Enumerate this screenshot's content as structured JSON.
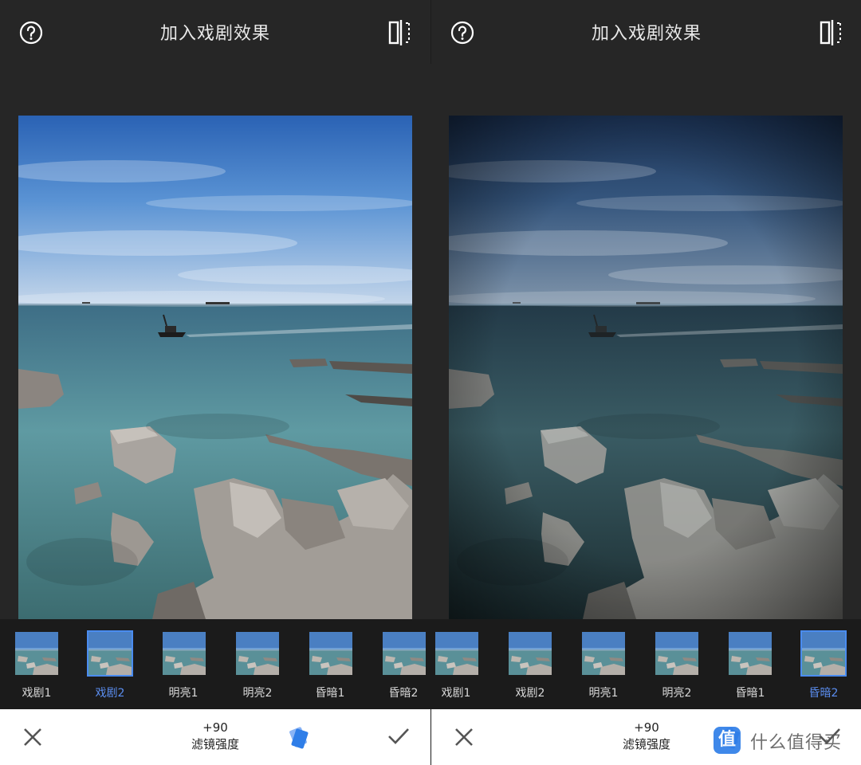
{
  "screens": [
    {
      "title": "加入戏剧效果",
      "filters": [
        {
          "label": "戏剧1",
          "selected": false
        },
        {
          "label": "戏剧2",
          "selected": true
        },
        {
          "label": "明亮1",
          "selected": false
        },
        {
          "label": "明亮2",
          "selected": false
        },
        {
          "label": "昏暗1",
          "selected": false
        },
        {
          "label": "昏暗2",
          "selected": false
        }
      ],
      "strength_value": "+90",
      "strength_label": "滤镜强度"
    },
    {
      "title": "加入戏剧效果",
      "filters": [
        {
          "label": "戏剧1",
          "selected": false
        },
        {
          "label": "戏剧2",
          "selected": false
        },
        {
          "label": "明亮1",
          "selected": false
        },
        {
          "label": "明亮2",
          "selected": false
        },
        {
          "label": "昏暗1",
          "selected": false
        },
        {
          "label": "昏暗2",
          "selected": true
        }
      ],
      "strength_value": "+90",
      "strength_label": "滤镜强度"
    }
  ],
  "icons": [
    "help-icon",
    "compare-icon",
    "close-icon",
    "style-icon",
    "check-icon"
  ],
  "colors": {
    "background": "#262626",
    "strip": "#1b1b1b",
    "accent": "#4a8cf0",
    "title_text": "#e8e8e8"
  },
  "watermark": {
    "logo": "值",
    "text": "什么值得买"
  }
}
